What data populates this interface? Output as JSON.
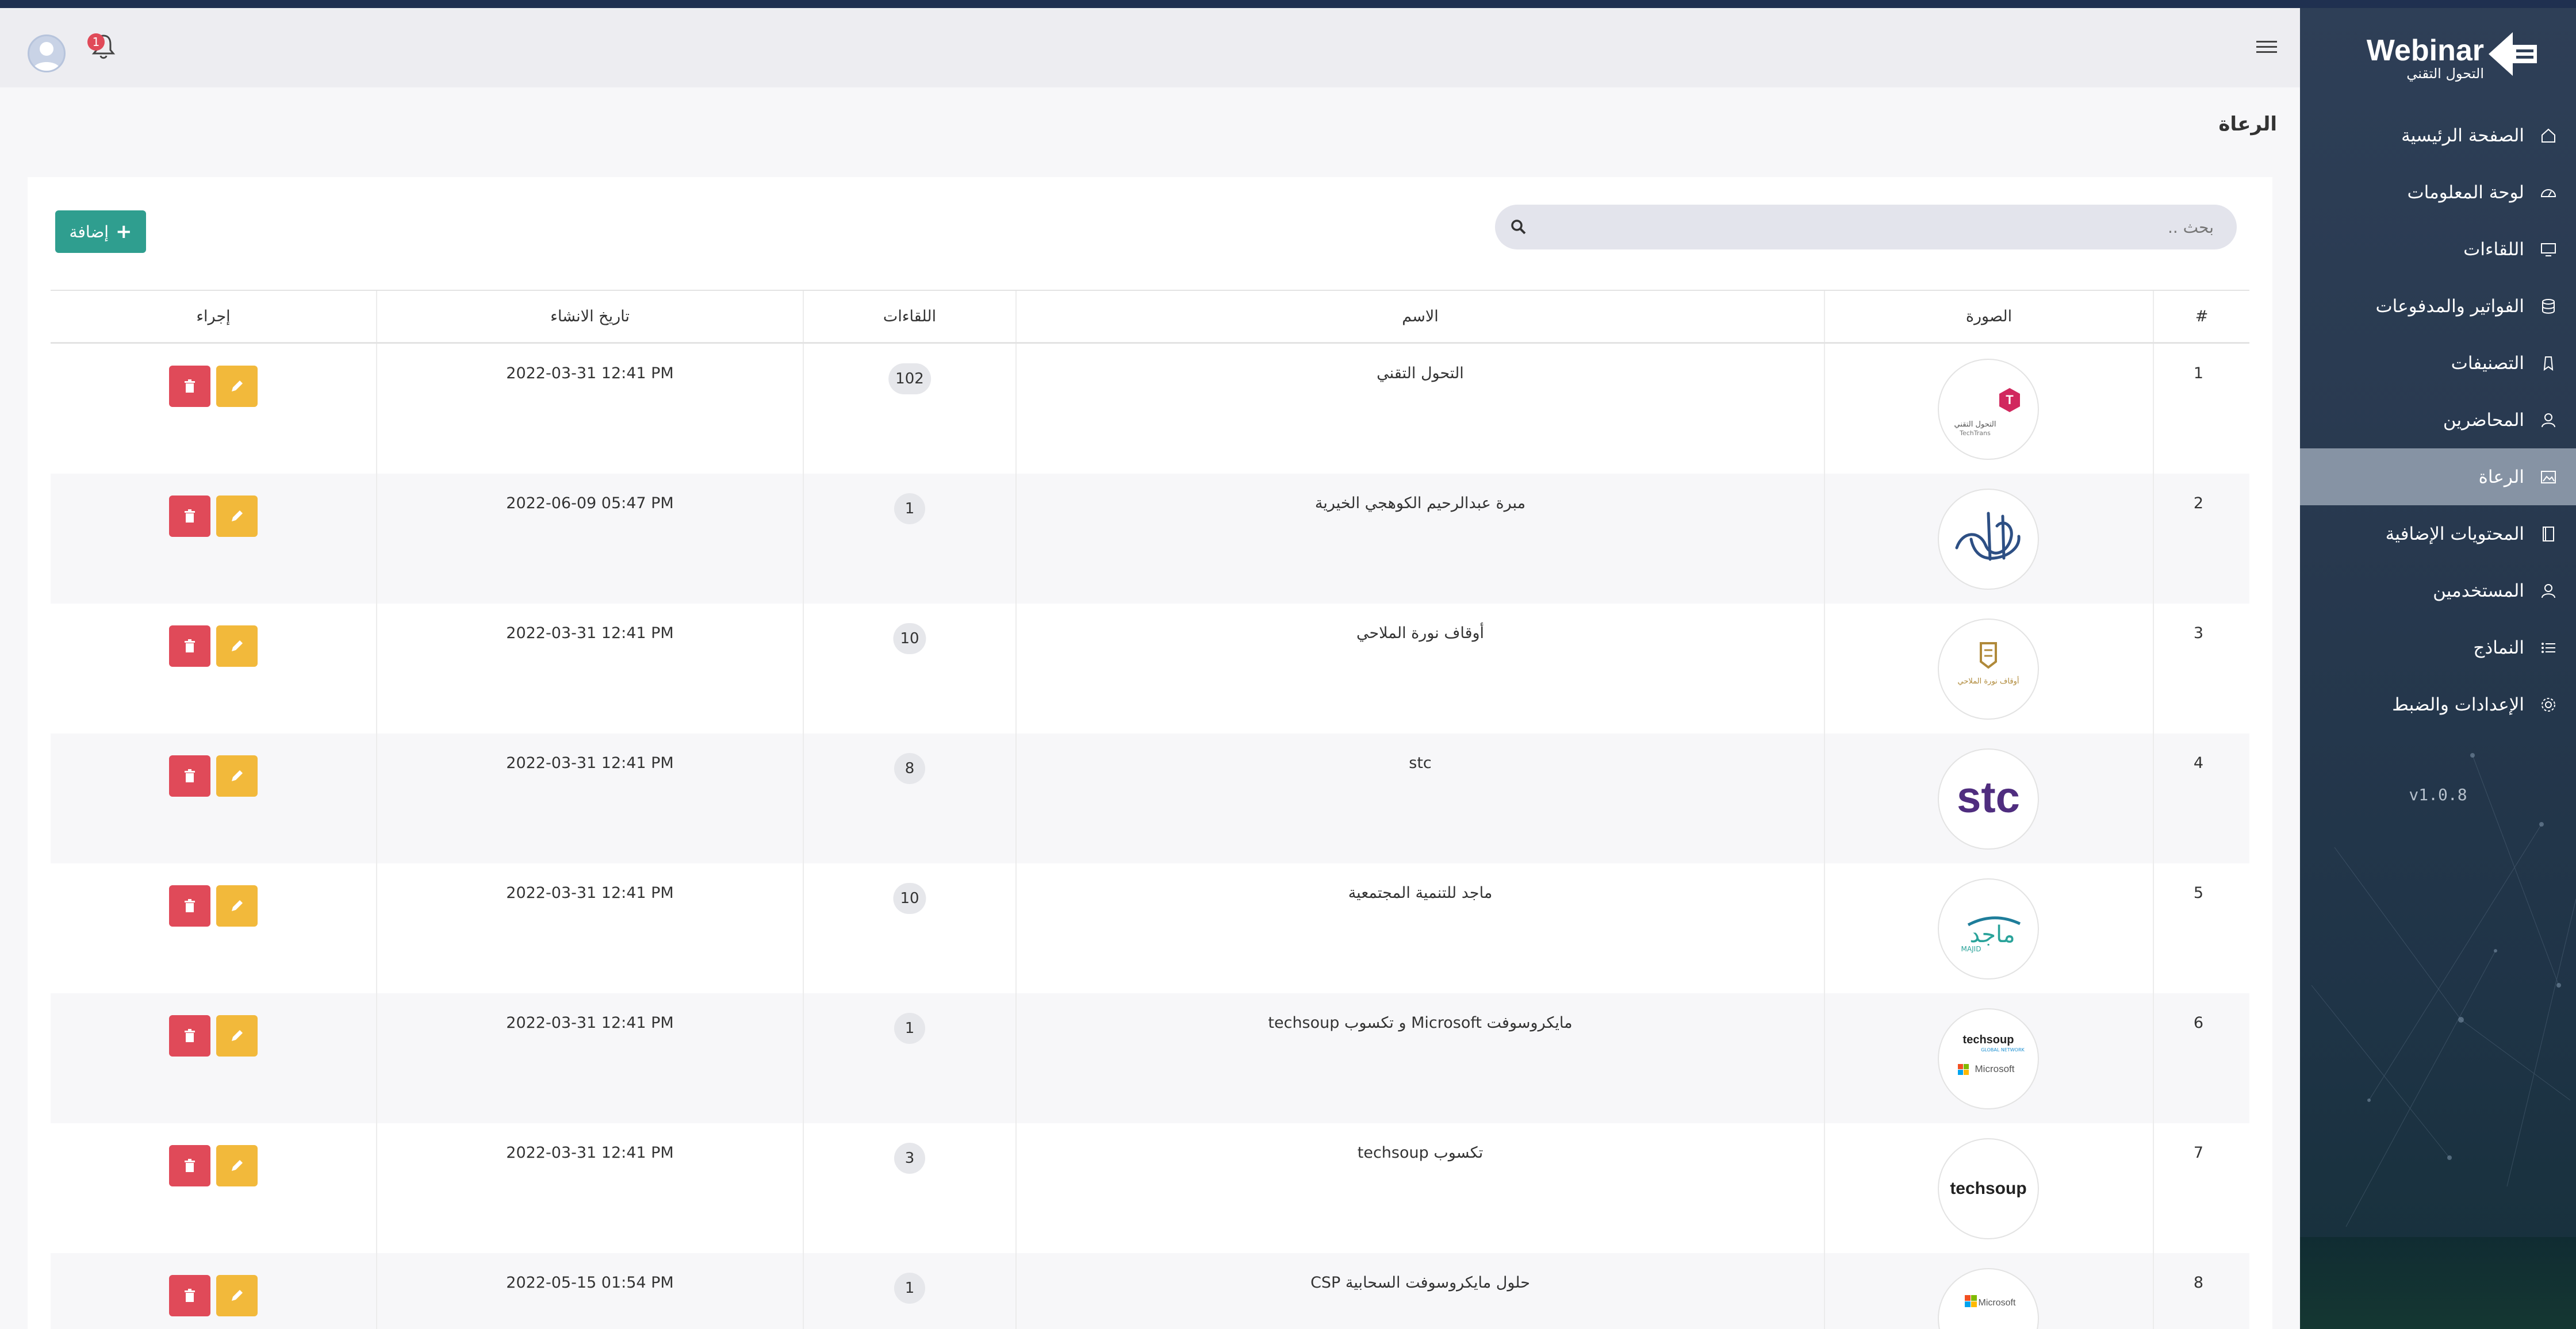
{
  "brand": {
    "name": "Webinar",
    "subtitle": "التحول التقني",
    "accent": "#2f9e8f",
    "sidebar_bg": "#2e3f57",
    "active_item_bg": "#8693a4"
  },
  "header": {
    "menu_icon": "hamburger-icon",
    "notification_count": "1",
    "notification_icon": "bell-icon",
    "avatar_icon": "user-avatar-icon"
  },
  "sidebar": {
    "items": [
      {
        "label": "الصفحة الرئيسية",
        "icon": "home-icon",
        "active": false
      },
      {
        "label": "لوحة المعلومات",
        "icon": "dashboard-icon",
        "active": false
      },
      {
        "label": "اللقاءات",
        "icon": "monitor-icon",
        "active": false
      },
      {
        "label": "الفواتير والمدفوعات",
        "icon": "database-icon",
        "active": false
      },
      {
        "label": "التصنيفات",
        "icon": "tag-icon",
        "active": false
      },
      {
        "label": "المحاضرين",
        "icon": "user-icon",
        "active": false
      },
      {
        "label": "الرعاة",
        "icon": "image-icon",
        "active": true
      },
      {
        "label": "المحتويات الإضافية",
        "icon": "book-icon",
        "active": false
      },
      {
        "label": "المستخدمين",
        "icon": "user-icon",
        "active": false
      },
      {
        "label": "النماذج",
        "icon": "list-icon",
        "active": false
      },
      {
        "label": "الإعدادات والضبط",
        "icon": "gear-icon",
        "active": false
      }
    ],
    "version": "v1.0.8"
  },
  "page": {
    "title": "الرعاة",
    "search_placeholder": "بحث ..",
    "add_button_label": "إضافة",
    "add_icon": "plus-icon"
  },
  "table": {
    "columns": [
      "#",
      "الصورة",
      "الاسم",
      "اللقاءات",
      "تاريخ الانشاء",
      "إجراء"
    ],
    "rows": [
      {
        "num": "1",
        "name": "التحول التقني",
        "meetings": "102",
        "created": "2022-03-31 12:41 PM",
        "logo": "techtrans"
      },
      {
        "num": "2",
        "name": "مبرة عبدالرحيم الكوهجي الخيرية",
        "meetings": "1",
        "created": "2022-06-09 05:47 PM",
        "logo": "calligraphy"
      },
      {
        "num": "3",
        "name": "أوقاف نورة الملاحي",
        "meetings": "10",
        "created": "2022-03-31 12:41 PM",
        "logo": "awqaf"
      },
      {
        "num": "4",
        "name": "stc",
        "meetings": "8",
        "created": "2022-03-31 12:41 PM",
        "logo": "stc"
      },
      {
        "num": "5",
        "name": "ماجد للتنمية المجتمعية",
        "meetings": "10",
        "created": "2022-03-31 12:41 PM",
        "logo": "majid"
      },
      {
        "num": "6",
        "name": "مايكروسوفت Microsoft و تكسوب techsoup",
        "meetings": "1",
        "created": "2022-03-31 12:41 PM",
        "logo": "techsoup-ms"
      },
      {
        "num": "7",
        "name": "تكسوب techsoup",
        "meetings": "3",
        "created": "2022-03-31 12:41 PM",
        "logo": "techsoup"
      },
      {
        "num": "8",
        "name": "حلول مايكروسوفت السحابية CSP",
        "meetings": "1",
        "created": "2022-05-15 01:54 PM",
        "logo": "microsoft"
      }
    ],
    "logo_text": {
      "techtrans_ar": "التحول التقني",
      "techtrans_en": "TechTrans",
      "stc": "stc",
      "majid_ar": "ماجد",
      "majid_en": "MAJID",
      "techsoup": "techsoup",
      "techsoup_global": "GLOBAL NETWORK",
      "microsoft": "Microsoft",
      "awqaf_ar": "أوقاف نورة الملاحي"
    },
    "delete_icon": "trash-icon",
    "edit_icon": "pencil-icon",
    "delete_color": "#e04a59",
    "edit_color": "#f2b93b"
  }
}
